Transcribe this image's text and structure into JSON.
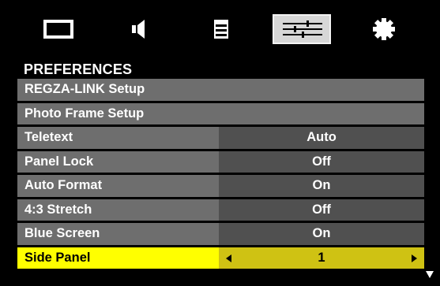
{
  "tabs": [
    {
      "icon": "picture-icon",
      "selected": false
    },
    {
      "icon": "sound-icon",
      "selected": false
    },
    {
      "icon": "setup-icon",
      "selected": false
    },
    {
      "icon": "preferences-sliders-icon",
      "selected": true
    },
    {
      "icon": "gear-icon",
      "selected": false
    }
  ],
  "menu": {
    "title": "PREFERENCES",
    "items": [
      {
        "label": "REGZA-LINK Setup"
      },
      {
        "label": "Photo Frame Setup"
      },
      {
        "label": "Teletext",
        "value": "Auto"
      },
      {
        "label": "Panel Lock",
        "value": "Off"
      },
      {
        "label": "Auto Format",
        "value": "On"
      },
      {
        "label": "4:3 Stretch",
        "value": "Off"
      },
      {
        "label": "Blue Screen",
        "value": "On"
      },
      {
        "label": "Side Panel",
        "value": "1",
        "selected": true
      }
    ]
  },
  "colors": {
    "label_bg": "#6e6e6e",
    "value_bg": "#505050",
    "highlight": "#ffff00",
    "highlight_value": "#cfc213"
  }
}
